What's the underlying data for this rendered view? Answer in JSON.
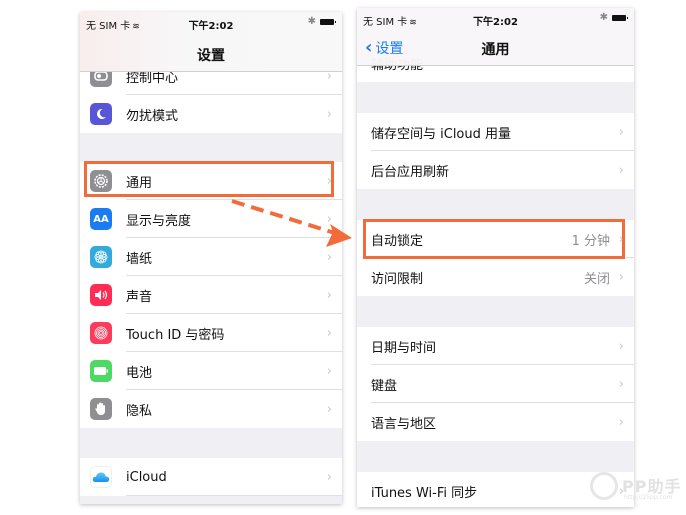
{
  "left_phone": {
    "status": {
      "carrier": "无 SIM 卡",
      "time": "下午2:02",
      "bluetooth": "bluetooth-icon",
      "battery": "battery-icon"
    },
    "title": "设置",
    "rows": [
      {
        "label": "控制中心",
        "icon": "control-center-icon",
        "icon_color": "#8e8e93"
      },
      {
        "label": "勿扰模式",
        "icon": "moon-icon",
        "icon_color": "#5856d6"
      },
      {
        "label": "通用",
        "icon": "gear-icon",
        "icon_color": "#8e8e93"
      },
      {
        "label": "显示与亮度",
        "icon": "display-icon",
        "icon_color": "#1a7cf0",
        "icon_text": "AA"
      },
      {
        "label": "墙纸",
        "icon": "wallpaper-flower-icon",
        "icon_color": "#34aadc"
      },
      {
        "label": "声音",
        "icon": "speaker-icon",
        "icon_color": "#ff2d55"
      },
      {
        "label": "Touch ID 与密码",
        "icon": "fingerprint-icon",
        "icon_color": "#ff3b5c"
      },
      {
        "label": "电池",
        "icon": "battery-icon",
        "icon_color": "#4cd964"
      },
      {
        "label": "隐私",
        "icon": "hand-icon",
        "icon_color": "#8e8e93"
      },
      {
        "label": "iCloud",
        "icon": "cloud-icon",
        "icon_color": "#ffffff"
      }
    ]
  },
  "right_phone": {
    "status": {
      "carrier": "无 SIM 卡",
      "time": "下午2:02",
      "bluetooth": "bluetooth-icon",
      "battery": "battery-icon"
    },
    "back_label": "设置",
    "title": "通用",
    "rows": [
      {
        "label": "辅助功能"
      },
      {
        "label": "储存空间与 iCloud 用量"
      },
      {
        "label": "后台应用刷新"
      },
      {
        "label": "自动锁定",
        "value": "1 分钟"
      },
      {
        "label": "访问限制",
        "value": "关闭"
      },
      {
        "label": "日期与时间"
      },
      {
        "label": "键盘"
      },
      {
        "label": "语言与地区"
      },
      {
        "label": "iTunes Wi-Fi 同步"
      }
    ]
  },
  "annotation": {
    "highlight_color": "#f26b3a",
    "highlighted_left": "通用",
    "highlighted_right": "自动锁定"
  },
  "watermark": {
    "brand": "PP助手",
    "url": "http://25pp.com"
  },
  "chevron": "›"
}
